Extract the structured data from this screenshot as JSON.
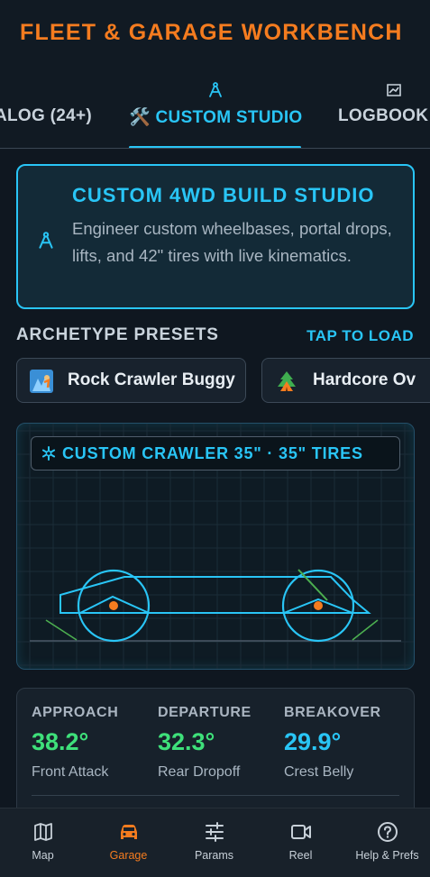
{
  "app": {
    "title": "FLEET & GARAGE WORKBENCH"
  },
  "tabs": [
    {
      "label": "ALOG (24+)",
      "icon": "catalog-icon",
      "active": false
    },
    {
      "label": "🛠️ CUSTOM STUDIO",
      "icon": "compass-icon",
      "active": true
    },
    {
      "label": "LOGBOOK (",
      "icon": "map-icon",
      "active": false
    }
  ],
  "hero": {
    "title": "CUSTOM 4WD BUILD STUDIO",
    "description": "Engineer custom wheelbases, portal drops, lifts, and 42\" tires with live kinematics.",
    "icon": "compass-icon"
  },
  "presets": {
    "title": "ARCHETYPE PRESETS",
    "action": "TAP TO LOAD",
    "items": [
      {
        "label": "Rock Crawler Buggy",
        "emoji": "🧗"
      },
      {
        "label": "Hardcore Ov",
        "emoji": "🏕️"
      }
    ]
  },
  "visualizer": {
    "badge": "CUSTOM CRAWLER 35\" · 35\" TIRES",
    "badge_icon": "gear-icon",
    "colors": {
      "accent": "#29c5f6",
      "pivot": "#f57c1f",
      "angle": "#4caf50"
    }
  },
  "stats": [
    {
      "label": "APPROACH",
      "value": "38.2°",
      "sub": "Front Attack",
      "color": "#3ee07a"
    },
    {
      "label": "DEPARTURE",
      "value": "32.3°",
      "sub": "Rear Dropoff",
      "color": "#3ee07a"
    },
    {
      "label": "BREAKOVER",
      "value": "29.9°",
      "sub": "Crest Belly",
      "color": "#29c5f6"
    }
  ],
  "nav": [
    {
      "label": "Map",
      "icon": "map-icon",
      "active": false
    },
    {
      "label": "Garage",
      "icon": "car-icon",
      "active": true
    },
    {
      "label": "Params",
      "icon": "sliders-icon",
      "active": false
    },
    {
      "label": "Reel",
      "icon": "video-icon",
      "active": false
    },
    {
      "label": "Help & Prefs",
      "icon": "help-icon",
      "active": false
    }
  ],
  "colors": {
    "accent": "#29c5f6",
    "brand": "#f57c1f",
    "good": "#3ee07a"
  }
}
